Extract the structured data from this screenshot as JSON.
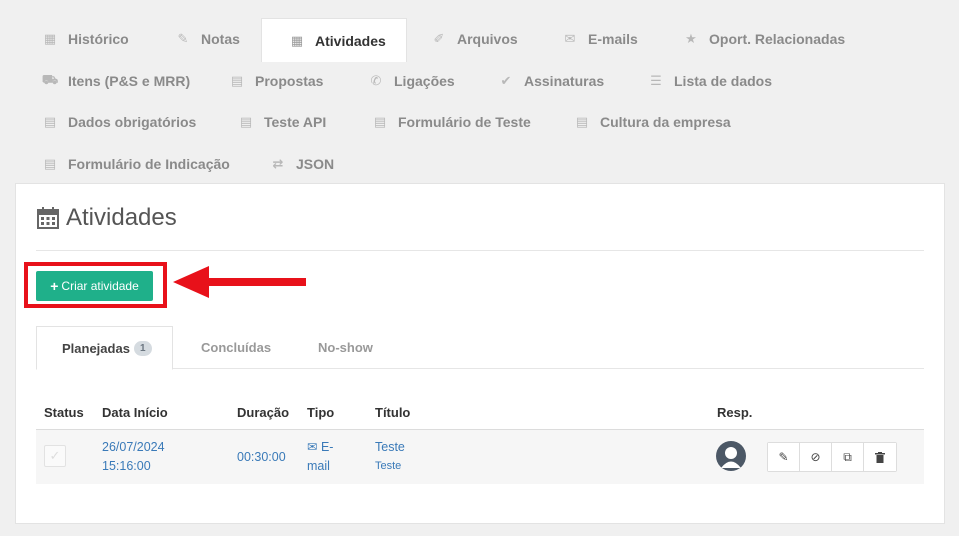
{
  "top_tabs": [
    {
      "label": "Histórico",
      "icon": "calendar-icon"
    },
    {
      "label": "Notas",
      "icon": "edit-icon"
    },
    {
      "label": "Atividades",
      "icon": "calendar-icon",
      "active": true
    },
    {
      "label": "Arquivos",
      "icon": "paperclip-icon"
    },
    {
      "label": "E-mails",
      "icon": "envelope-icon"
    },
    {
      "label": "Oport. Relacionadas",
      "icon": "star-icon"
    },
    {
      "label": "Itens (P&S e MRR)",
      "icon": "cart-icon"
    },
    {
      "label": "Propostas",
      "icon": "document-icon"
    },
    {
      "label": "Ligações",
      "icon": "phone-icon"
    },
    {
      "label": "Assinaturas",
      "icon": "check-circle-icon"
    },
    {
      "label": "Lista de dados",
      "icon": "list-icon"
    },
    {
      "label": "Dados obrigatórios",
      "icon": "document-icon"
    },
    {
      "label": "Teste API",
      "icon": "document-icon"
    },
    {
      "label": "Formulário de Teste",
      "icon": "document-icon"
    },
    {
      "label": "Cultura da empresa",
      "icon": "document-icon"
    },
    {
      "label": "Formulário de Indicação",
      "icon": "document-icon"
    },
    {
      "label": "JSON",
      "icon": "exchange-icon"
    }
  ],
  "panel": {
    "title": "Atividades",
    "create_button": "Criar atividade"
  },
  "sub_tabs": [
    {
      "label": "Planejadas",
      "badge": "1"
    },
    {
      "label": "Concluídas"
    },
    {
      "label": "No-show"
    }
  ],
  "table": {
    "headers": {
      "status": "Status",
      "start": "Data Início",
      "duration": "Duração",
      "type": "Tipo",
      "title": "Título",
      "resp": "Resp."
    },
    "rows": [
      {
        "date": "26/07/2024",
        "time": "15:16:00",
        "duration": "00:30:00",
        "type_a": "E-",
        "type_b": "mail",
        "title": "Teste",
        "subtitle": "Teste"
      }
    ]
  },
  "colors": {
    "accent": "#1fb08a",
    "highlight": "#e8111a",
    "link": "#3a7ab8"
  }
}
